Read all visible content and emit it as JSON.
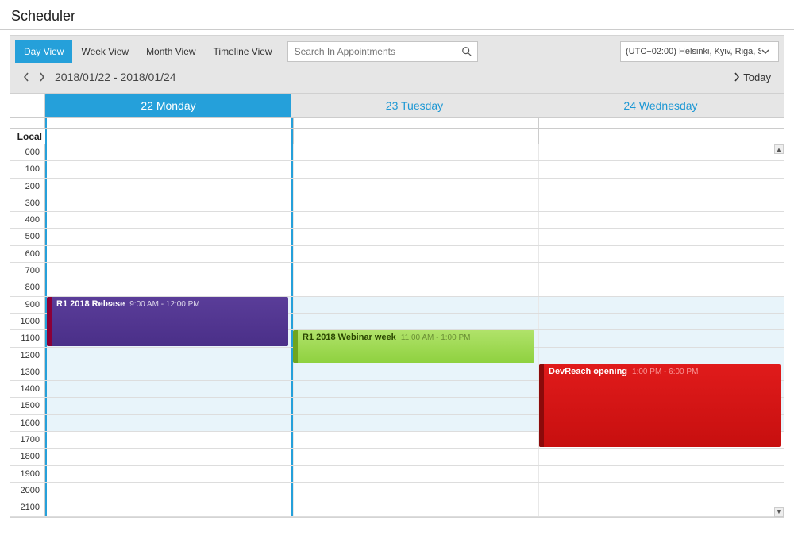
{
  "page_title": "Scheduler",
  "toolbar": {
    "views": [
      "Day View",
      "Week View",
      "Month View",
      "Timeline View"
    ],
    "active_view_index": 0,
    "search_placeholder": "Search In Appointments",
    "timezone_label": "(UTC+02:00) Helsinki, Kyiv, Riga, S"
  },
  "nav": {
    "date_range": "2018/01/22 - 2018/01/24",
    "today_label": "Today"
  },
  "ruler_header": "Local",
  "days": [
    {
      "label": "22 Monday",
      "active": true
    },
    {
      "label": "23 Tuesday",
      "active": false
    },
    {
      "label": "24 Wednesday",
      "active": false
    }
  ],
  "hours": [
    "000",
    "100",
    "200",
    "300",
    "400",
    "500",
    "600",
    "700",
    "800",
    "900",
    "1000",
    "1100",
    "1200",
    "1300",
    "1400",
    "1500",
    "1600",
    "1700",
    "1800",
    "1900",
    "2000",
    "2100"
  ],
  "work_start_index": 9,
  "work_end_index": 17,
  "appointments": [
    {
      "title": "R1 2018 Release",
      "time": "9:00 AM - 12:00 PM",
      "day": 0,
      "start": 9,
      "end": 12,
      "color": "purple"
    },
    {
      "title": "R1 2018 Webinar week",
      "time": "11:00 AM - 1:00 PM",
      "day": 1,
      "start": 11,
      "end": 13,
      "color": "green"
    },
    {
      "title": "DevReach opening",
      "time": "1:00 PM - 6:00 PM",
      "day": 2,
      "start": 13,
      "end": 18,
      "color": "red"
    }
  ]
}
